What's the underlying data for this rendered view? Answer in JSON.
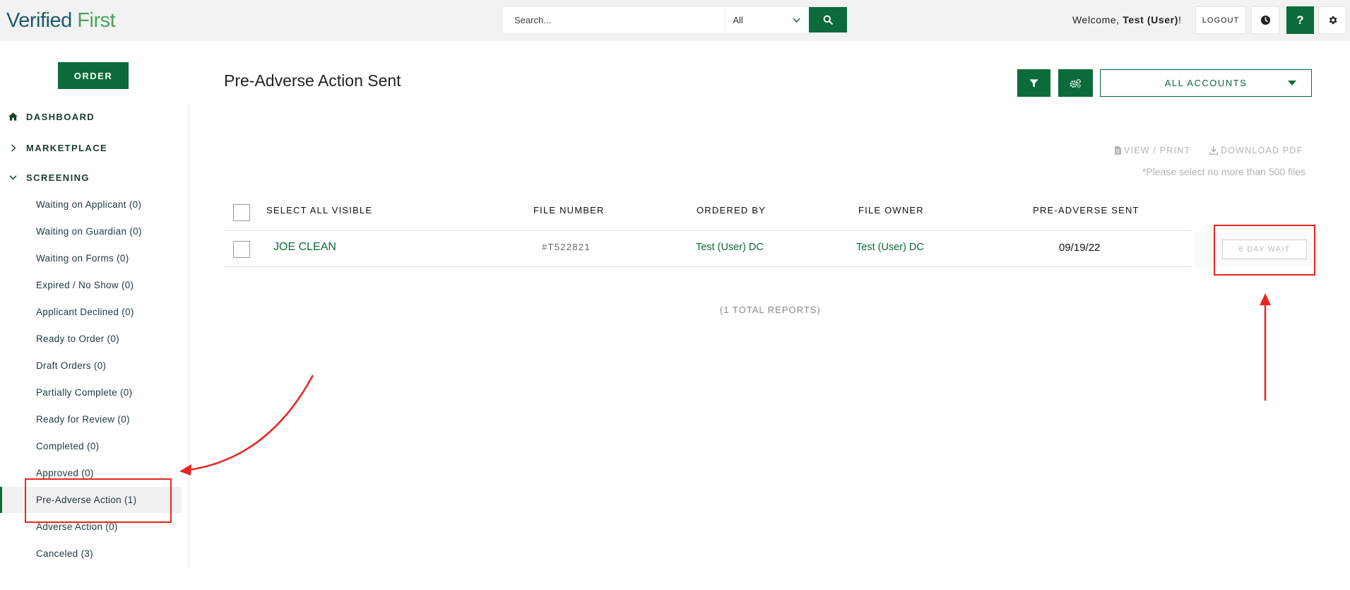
{
  "brand": {
    "word1": "Verified",
    "word2": "First"
  },
  "search": {
    "placeholder": "Search...",
    "scope": "All"
  },
  "user": {
    "welcome_prefix": "Welcome, ",
    "name": "Test (User)",
    "welcome_suffix": "!"
  },
  "topbar": {
    "logout_label": "LOGOUT",
    "help_label": "?"
  },
  "sidebar": {
    "order_label": "ORDER",
    "dashboard": "DASHBOARD",
    "marketplace": "MARKETPLACE",
    "screening": "SCREENING",
    "items": [
      {
        "label": "Waiting on Applicant (0)"
      },
      {
        "label": "Waiting on Guardian (0)"
      },
      {
        "label": "Waiting on Forms (0)"
      },
      {
        "label": "Expired / No Show (0)"
      },
      {
        "label": "Applicant Declined (0)"
      },
      {
        "label": "Ready to Order (0)"
      },
      {
        "label": "Draft Orders (0)"
      },
      {
        "label": "Partially Complete (0)"
      },
      {
        "label": "Ready for Review (0)"
      },
      {
        "label": "Completed (0)"
      },
      {
        "label": "Approved (0)"
      },
      {
        "label": "Pre-Adverse Action (1)",
        "active": true
      },
      {
        "label": "Adverse Action (0)"
      },
      {
        "label": "Canceled (3)"
      }
    ]
  },
  "main": {
    "title": "Pre-Adverse Action Sent",
    "accounts_label": "ALL ACCOUNTS",
    "view_print": "VIEW / PRINT",
    "download_pdf": "DOWNLOAD PDF",
    "note": "*Please select no more than 500 files",
    "columns": {
      "select_all": "SELECT ALL VISIBLE",
      "file_number": "FILE NUMBER",
      "ordered_by": "ORDERED BY",
      "file_owner": "FILE OWNER",
      "pre_adverse_sent": "PRE-ADVERSE SENT"
    },
    "rows": [
      {
        "name": "JOE CLEAN",
        "file_number": "#T522821",
        "ordered_by": "Test (User) DC",
        "file_owner": "Test (User) DC",
        "pre_adverse_sent": "09/19/22",
        "action": "6 DAY WAIT"
      }
    ],
    "total": "(1 TOTAL REPORTS)"
  },
  "colors": {
    "brand_green": "#0b6b3a",
    "annotation_red": "#e8251f"
  }
}
